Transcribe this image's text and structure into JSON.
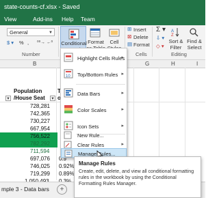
{
  "title_bar": {
    "title": "state-counts-cf.xlsx  -  Saved"
  },
  "tabs": [
    "View",
    "Add-ins",
    "Help",
    "Team"
  ],
  "ribbon": {
    "number_format": "General",
    "number_group_label": "Number",
    "conditional_formatting_label": "Conditional Formatting",
    "format_as_table_label": "Format as Table",
    "cell_styles_label": "Cell Styles",
    "insert_label": "Insert",
    "delete_label": "Delete",
    "format_label": "Format",
    "cells_group_label": "Cells",
    "sort_filter_label": "Sort & Filter",
    "find_select_label": "Find & Select",
    "editing_group_label": "Editing",
    "percent": "%",
    "comma": ","
  },
  "columns": [
    "B",
    "C",
    "F",
    "G",
    "H",
    "I"
  ],
  "sheet": {
    "header_line1": "Population",
    "header_line2": "/House Seat",
    "header_col_c": "T",
    "header_col_c2": "o",
    "rows": [
      {
        "pop": "728,281"
      },
      {
        "pop": "742,365"
      },
      {
        "pop": "730,227"
      },
      {
        "pop": "667,954"
      },
      {
        "pop": "756,522"
      },
      {
        "pop": "782,292",
        "highlight": true
      },
      {
        "pop": "711,594",
        "highlight": true
      },
      {
        "pop": "697,076",
        "pct": "0.9"
      },
      {
        "pop": "746,025",
        "pct": "0.92%"
      },
      {
        "pop": "719,299",
        "pct": "0.89%"
      },
      {
        "pop": "1,050,493",
        "pct": "0.3%"
      }
    ]
  },
  "menu": {
    "items": [
      {
        "label": "Highlight Cells Rules",
        "icon": "highlight-cells-icon",
        "submenu": true
      },
      {
        "label": "Top/Bottom Rules",
        "icon": "top-bottom-icon",
        "submenu": true
      },
      {
        "label": "Data Bars",
        "icon": "data-bars-icon",
        "submenu": true
      },
      {
        "label": "Color Scales",
        "icon": "color-scales-icon",
        "submenu": true
      },
      {
        "label": "Icon Sets",
        "icon": "icon-sets-icon",
        "submenu": true
      },
      {
        "label": "New Rule...",
        "icon": "new-rule-icon",
        "submenu": false
      },
      {
        "label": "Clear Rules",
        "icon": "clear-rules-icon",
        "submenu": true
      },
      {
        "label": "Manage Rules...",
        "icon": "manage-rules-icon",
        "submenu": false,
        "hover": true
      }
    ]
  },
  "tooltip": {
    "title": "Manage Rules",
    "body": "Create, edit, delete, and view all conditional formatting rules in the workbook by using the Conditional Formatting Rules Manager."
  },
  "sheet_tab": {
    "label": "mple 3 - Data bars"
  },
  "colors": {
    "excel_green": "#217346",
    "highlight_green": "#10a050",
    "hover_blue": "#cde6f7"
  }
}
